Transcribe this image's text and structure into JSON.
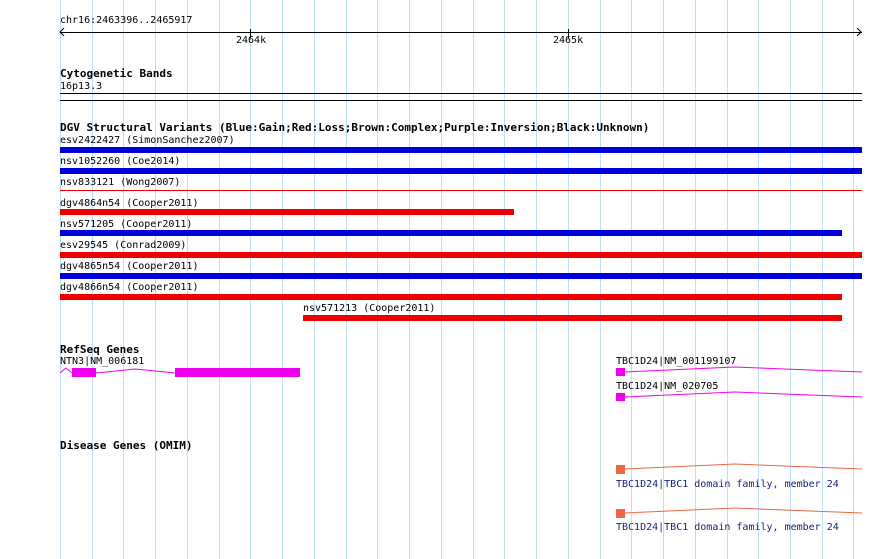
{
  "region": {
    "label": "chr16:2463396..2465917"
  },
  "ruler": {
    "ticks": [
      "2464k",
      "2465k"
    ]
  },
  "cytoband": {
    "title": "Cytogenetic Bands",
    "band": "16p13.3"
  },
  "dgv": {
    "title": "DGV Structural Variants (Blue:Gain;Red:Loss;Brown:Complex;Purple:Inversion;Black:Unknown)",
    "colors": {
      "gain": "#0000dd",
      "loss": "#ee0000"
    },
    "variants": [
      {
        "label": "esv2422427 (SimonSanchez2007)",
        "type": "gain"
      },
      {
        "label": "nsv1052260 (Coe2014)",
        "type": "gain"
      },
      {
        "label": "nsv833121 (Wong2007)",
        "type": "loss"
      },
      {
        "label": "dgv4864n54 (Cooper2011)",
        "type": "loss"
      },
      {
        "label": "nsv571205 (Cooper2011)",
        "type": "gain"
      },
      {
        "label": "esv29545 (Conrad2009)",
        "type": "loss"
      },
      {
        "label": "dgv4865n54 (Cooper2011)",
        "type": "gain"
      },
      {
        "label": "dgv4866n54 (Cooper2011)",
        "type": "loss"
      },
      {
        "label": "nsv571213 (Cooper2011)",
        "type": "loss"
      }
    ]
  },
  "refseq": {
    "title": "RefSeq Genes",
    "color": "#ee00ee",
    "genes": [
      {
        "label": "NTN3|NM_006181"
      },
      {
        "label": "TBC1D24|NM_001199107"
      },
      {
        "label": "TBC1D24|NM_020705"
      }
    ]
  },
  "omim": {
    "title": "Disease Genes (OMIM)",
    "color": "#ee6644",
    "genes": [
      {
        "label": "TBC1D24|TBC1 domain family, member 24"
      },
      {
        "label": "TBC1D24|TBC1 domain family, member 24"
      }
    ]
  }
}
